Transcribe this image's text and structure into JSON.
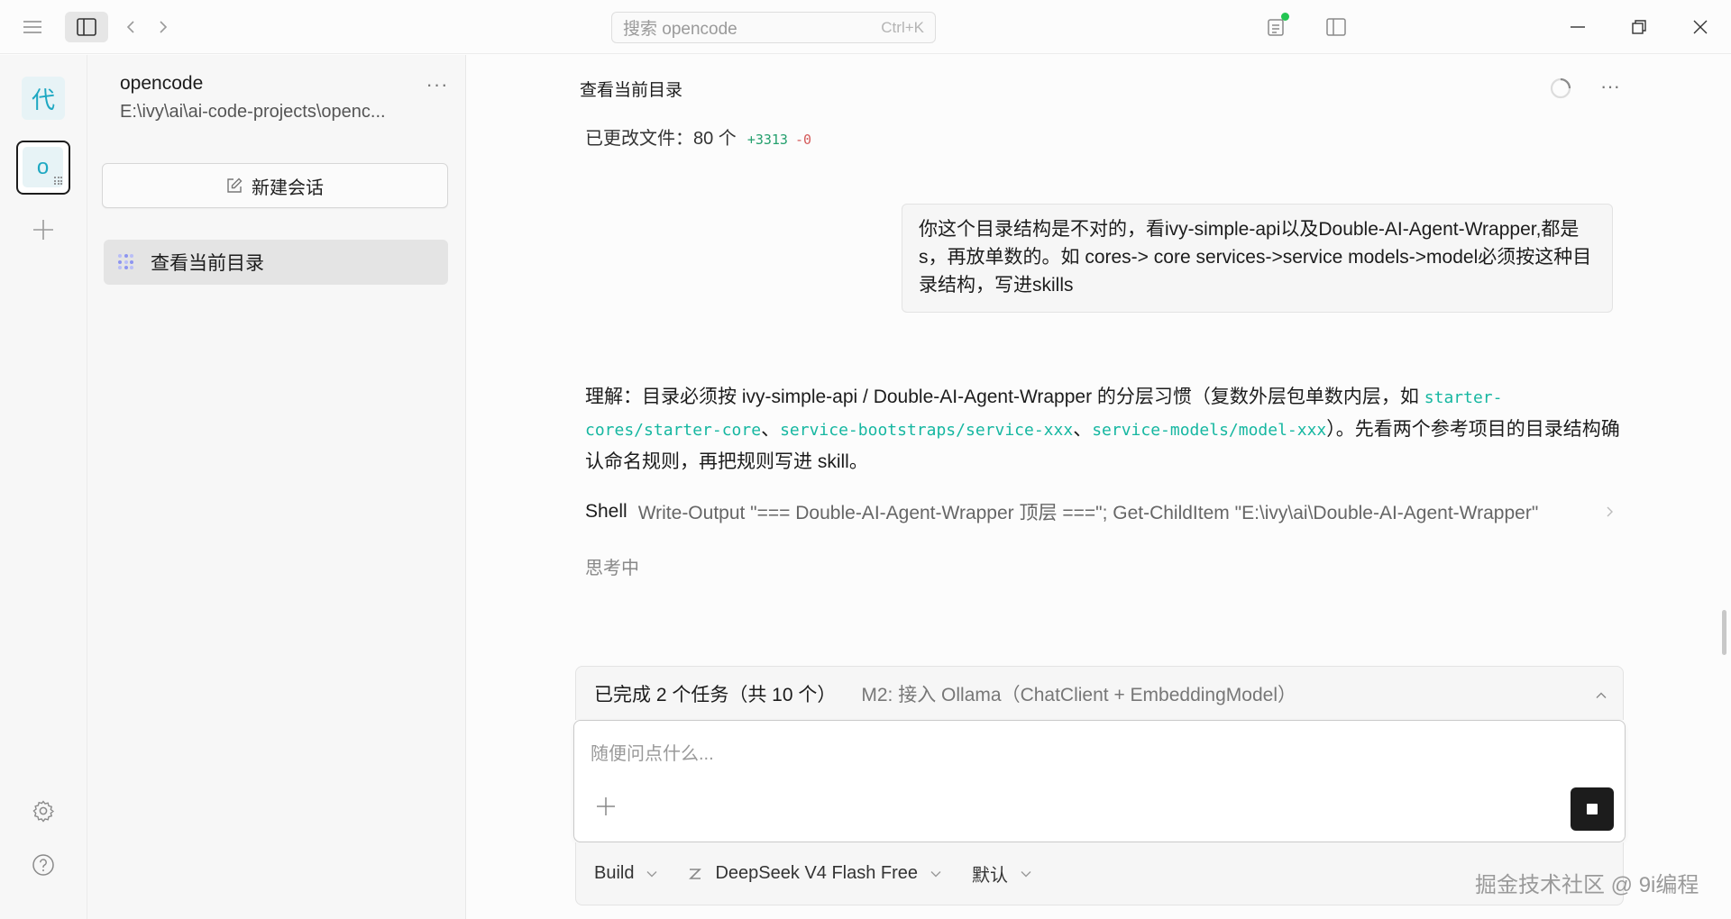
{
  "titlebar": {
    "search_placeholder": "搜索 opencode",
    "search_shortcut": "Ctrl+K"
  },
  "rail": {
    "projects": [
      {
        "initial": "代"
      },
      {
        "initial": "o"
      }
    ]
  },
  "sidebar": {
    "project_name": "opencode",
    "project_path": "E:\\ivy\\ai\\ai-code-projects\\openc...",
    "more": "···",
    "new_session_label": "新建会话",
    "sessions": [
      {
        "label": "查看当前目录"
      }
    ]
  },
  "main": {
    "session_title": "查看当前目录",
    "more": "···",
    "changed_label": "已更改文件：80 个",
    "additions": "+3313",
    "deletions": "-0",
    "user_message": "你这个目录结构是不对的，看ivy-simple-api以及Double-AI-Agent-Wrapper,都是s，再放单数的。如 cores-> core  services->service  models->model必须按这种目录结构，写进skills",
    "answer": {
      "part1": "理解：目录必须按 ivy-simple-api / Double-AI-Agent-Wrapper 的分层习惯（复数外层包单数内层，如 ",
      "code1": "starter-cores/starter-core",
      "sep1": "、",
      "code2": "service-bootstraps/service-xxx",
      "sep2": "、",
      "code3": "service-models/model-xxx",
      "part2": "）。先看两个参考项目的目录结构确认命名规则，再把规则写进 skill。"
    },
    "shell_label": "Shell",
    "shell_command": "Write-Output \"=== Double-AI-Agent-Wrapper 顶层 ===\"; Get-ChildItem \"E:\\ivy\\ai\\Double-AI-Agent-Wrapper\"",
    "thinking": "思考中"
  },
  "composer": {
    "todo_done": "已完成 2 个任务（共 10 个）",
    "todo_current": "M2: 接入 Ollama（ChatClient + EmbeddingModel）",
    "placeholder": "随便问点什么...",
    "agent": "Build",
    "model": "DeepSeek V4 Flash Free",
    "variant": "默认"
  },
  "watermark": "掘金技术社区 @ 9i编程",
  "colors": {
    "accent_teal": "#16b7a1",
    "add_green": "#25a06e",
    "delete_red": "#d45a5a",
    "status_green": "#23c552"
  }
}
